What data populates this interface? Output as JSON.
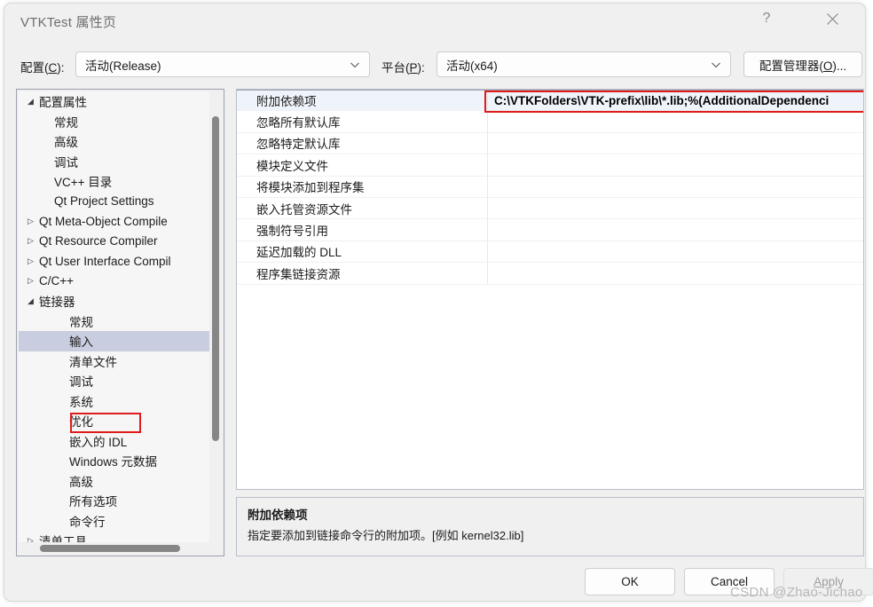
{
  "window": {
    "title": "VTKTest 属性页",
    "help_icon": "question-mark-icon",
    "close_icon": "close-icon"
  },
  "toolbar": {
    "configuration_label": "配置(C):",
    "configuration_value": "活动(Release)",
    "platform_label": "平台(P):",
    "platform_value": "活动(x64)",
    "config_manager_label": "配置管理器(O)...",
    "dropdown_icon": "chevron-down-icon"
  },
  "tree": {
    "items": [
      {
        "label": "配置属性",
        "indent": 0,
        "twisty": "expanded"
      },
      {
        "label": "常规",
        "indent": 1,
        "twisty": "none"
      },
      {
        "label": "高级",
        "indent": 1,
        "twisty": "none"
      },
      {
        "label": "调试",
        "indent": 1,
        "twisty": "none"
      },
      {
        "label": "VC++ 目录",
        "indent": 1,
        "twisty": "none"
      },
      {
        "label": "Qt Project Settings",
        "indent": 1,
        "twisty": "none"
      },
      {
        "label": "Qt Meta-Object Compile",
        "indent": 0,
        "twisty": "collapsed"
      },
      {
        "label": "Qt Resource Compiler",
        "indent": 0,
        "twisty": "collapsed"
      },
      {
        "label": "Qt User Interface Compil",
        "indent": 0,
        "twisty": "collapsed"
      },
      {
        "label": "C/C++",
        "indent": 0,
        "twisty": "collapsed"
      },
      {
        "label": "链接器",
        "indent": 0,
        "twisty": "expanded"
      },
      {
        "label": "常规",
        "indent": 2,
        "twisty": "none"
      },
      {
        "label": "输入",
        "indent": 2,
        "twisty": "none",
        "selected": true
      },
      {
        "label": "清单文件",
        "indent": 2,
        "twisty": "none"
      },
      {
        "label": "调试",
        "indent": 2,
        "twisty": "none"
      },
      {
        "label": "系统",
        "indent": 2,
        "twisty": "none"
      },
      {
        "label": "优化",
        "indent": 2,
        "twisty": "none"
      },
      {
        "label": "嵌入的 IDL",
        "indent": 2,
        "twisty": "none"
      },
      {
        "label": "Windows 元数据",
        "indent": 2,
        "twisty": "none"
      },
      {
        "label": "高级",
        "indent": 2,
        "twisty": "none"
      },
      {
        "label": "所有选项",
        "indent": 2,
        "twisty": "none"
      },
      {
        "label": "命令行",
        "indent": 2,
        "twisty": "none"
      },
      {
        "label": "清单工具",
        "indent": 0,
        "twisty": "collapsed"
      }
    ],
    "twisty_glyphs": {
      "expanded": "◢",
      "collapsed": "▷",
      "none": ""
    }
  },
  "grid": {
    "rows": [
      {
        "name": "附加依赖项",
        "value": "C:\\VTKFolders\\VTK-prefix\\lib\\*.lib;%(AdditionalDependenci",
        "active": true
      },
      {
        "name": "忽略所有默认库",
        "value": ""
      },
      {
        "name": "忽略特定默认库",
        "value": ""
      },
      {
        "name": "模块定义文件",
        "value": ""
      },
      {
        "name": "将模块添加到程序集",
        "value": ""
      },
      {
        "name": "嵌入托管资源文件",
        "value": ""
      },
      {
        "name": "强制符号引用",
        "value": ""
      },
      {
        "name": "延迟加载的 DLL",
        "value": ""
      },
      {
        "name": "程序集链接资源",
        "value": ""
      }
    ]
  },
  "description": {
    "title": "附加依赖项",
    "text": "指定要添加到链接命令行的附加项。[例如 kernel32.lib]"
  },
  "footer": {
    "ok_label": "OK",
    "cancel_label": "Cancel",
    "apply_label": "Apply"
  },
  "watermark": {
    "text": "CSDN @Zhao-Jichao"
  },
  "colors": {
    "dialog_background": "#f0f0f0",
    "annotation_red": "#e01b1b",
    "tree_selection": "#c8cddf",
    "grid_active_row": "#eff3fa"
  }
}
